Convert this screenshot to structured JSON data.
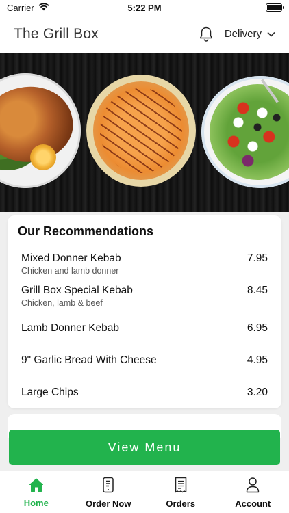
{
  "status_bar": {
    "carrier": "Carrier",
    "time": "5:22 PM",
    "battery_level": 1.0
  },
  "header": {
    "title": "The Grill Box",
    "notification_icon": "bell-icon",
    "delivery_label": "Delivery",
    "delivery_icon": "chevron-down-icon"
  },
  "hero": {
    "images": [
      "roast-chicken",
      "pizza",
      "greek-salad"
    ]
  },
  "recommendations": {
    "title": "Our Recommendations",
    "items": [
      {
        "name": "Mixed Donner Kebab",
        "description": "Chicken and lamb donner",
        "price": "7.95"
      },
      {
        "name": "Grill Box Special Kebab",
        "description": "Chicken, lamb & beef",
        "price": "8.45"
      },
      {
        "name": "Lamb Donner Kebab",
        "description": "",
        "price": "6.95"
      },
      {
        "name": "9\" Garlic Bread With Cheese",
        "description": "",
        "price": "4.95"
      },
      {
        "name": "Large Chips",
        "description": "",
        "price": "3.20"
      }
    ]
  },
  "view_menu_label": "View Menu",
  "tabs": [
    {
      "label": "Home",
      "icon": "home-icon",
      "active": true
    },
    {
      "label": "Order Now",
      "icon": "phone-order-icon",
      "active": false
    },
    {
      "label": "Orders",
      "icon": "receipt-icon",
      "active": false
    },
    {
      "label": "Account",
      "icon": "user-icon",
      "active": false
    }
  ],
  "colors": {
    "accent": "#22b34d",
    "text": "#111111",
    "background": "#efefef"
  }
}
